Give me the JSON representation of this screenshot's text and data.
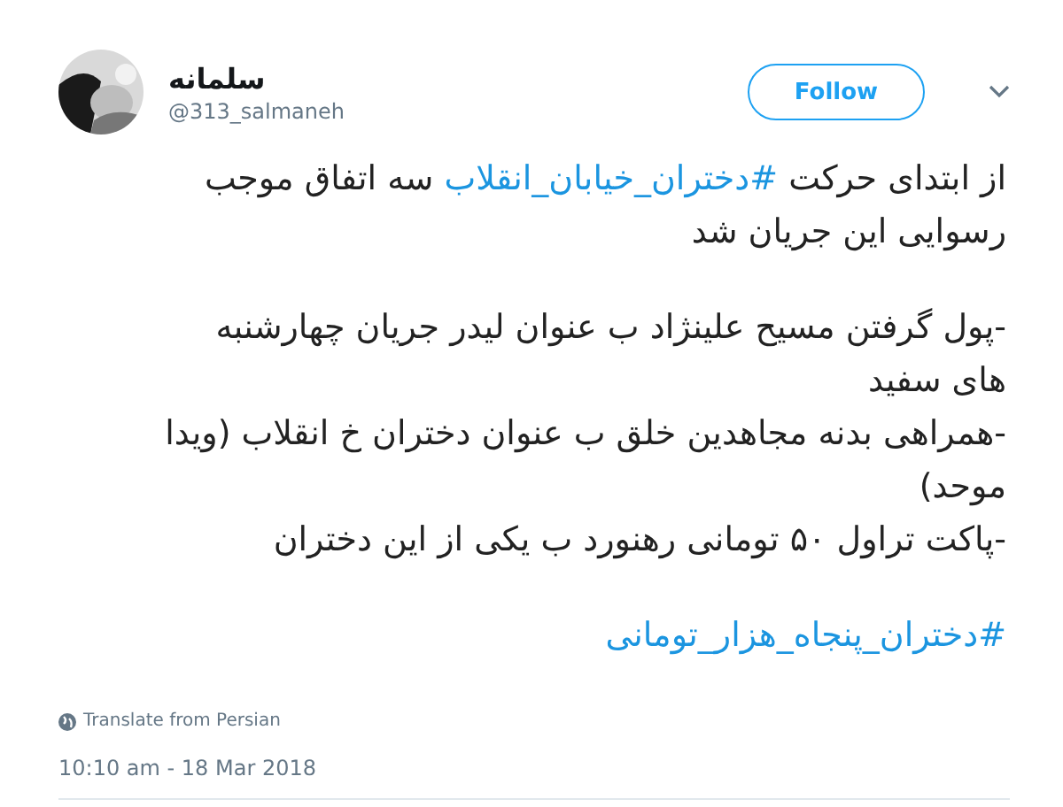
{
  "author": {
    "name": "سلمانه",
    "handle": "@313_salmaneh"
  },
  "follow_button": {
    "label": "Follow"
  },
  "paragraphs": [
    [
      [
        {
          "kind": "text",
          "text": "از ابتدای حرکت "
        },
        {
          "kind": "hashtag",
          "text": "#دختران_خیابان_انقلاب"
        },
        {
          "kind": "text",
          "text": " سه اتفاق موجب"
        }
      ],
      [
        {
          "kind": "text",
          "text": "رسوایی این جریان شد"
        }
      ]
    ],
    [
      [
        {
          "kind": "text",
          "text": "-پول گرفتن مسیح علینژاد ب عنوان لیدر جریان چهارشنبه"
        }
      ],
      [
        {
          "kind": "text",
          "text": "های سفید"
        }
      ],
      [
        {
          "kind": "text",
          "text": "-همراهی بدنه مجاهدین خلق ب عنوان دختران خ انقلاب (ویدا"
        }
      ],
      [
        {
          "kind": "text",
          "text": "موحد)"
        }
      ],
      [
        {
          "kind": "text",
          "text": "-پاکت تراول ۵۰ تومانی رهنورد ب یکی از این دختران"
        }
      ]
    ],
    [
      [
        {
          "kind": "hashtag",
          "text": "#دختران_پنجاه_هزار_تومانی"
        }
      ]
    ]
  ],
  "translate_link": "Translate from Persian",
  "timestamp": "10:10 am - 18 Mar 2018"
}
